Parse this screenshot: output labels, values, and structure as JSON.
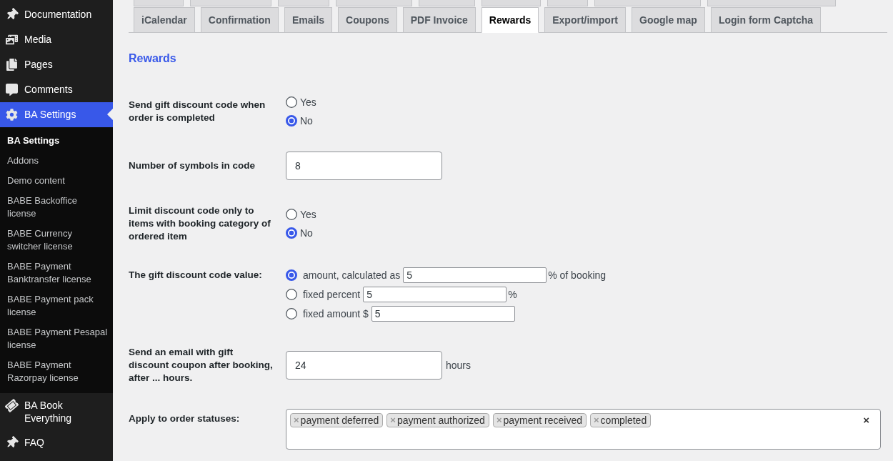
{
  "sidebar": {
    "items": [
      {
        "label": "Documentation",
        "selected": false
      },
      {
        "label": "Media",
        "selected": false
      },
      {
        "label": "Pages",
        "selected": false
      },
      {
        "label": "Comments",
        "selected": false
      },
      {
        "label": "BA Settings",
        "selected": true,
        "submenu": [
          {
            "label": "BA Settings",
            "selected": true
          },
          {
            "label": "Addons",
            "selected": false
          },
          {
            "label": "Demo content",
            "selected": false
          },
          {
            "label": "BABE Backoffice license",
            "selected": false
          },
          {
            "label": "BABE Currency switcher license",
            "selected": false
          },
          {
            "label": "BABE Payment Banktransfer license",
            "selected": false
          },
          {
            "label": "BABE Payment pack license",
            "selected": false
          },
          {
            "label": "BABE Payment Pesapal license",
            "selected": false
          },
          {
            "label": "BABE Payment Razorpay license",
            "selected": false
          }
        ]
      },
      {
        "label": "BA Book Everything",
        "selected": false
      },
      {
        "label": "FAQ",
        "selected": false
      }
    ]
  },
  "upper_tabs": [
    {
      "selected": false
    },
    {
      "selected": false
    },
    {
      "selected": false
    },
    {
      "selected": false
    },
    {
      "selected": false
    },
    {
      "selected": false
    },
    {
      "selected": false
    },
    {
      "selected": false
    },
    {
      "selected": false
    }
  ],
  "tabs": [
    {
      "label": "iCalendar",
      "selected": false
    },
    {
      "label": "Confirmation",
      "selected": false
    },
    {
      "label": "Emails",
      "selected": false
    },
    {
      "label": "Coupons",
      "selected": false
    },
    {
      "label": "PDF Invoice",
      "selected": false
    },
    {
      "label": "Rewards",
      "selected": true
    },
    {
      "label": "Export/import",
      "selected": false
    },
    {
      "label": "Google map",
      "selected": false
    },
    {
      "label": "Login form Captcha",
      "selected": false
    }
  ],
  "section_title": "Rewards",
  "fields": [
    {
      "kind": "radio",
      "label": "Send gift discount code when order is completed",
      "options": [
        {
          "label": "Yes",
          "selected": false
        },
        {
          "label": "No",
          "selected": true
        }
      ]
    },
    {
      "kind": "text",
      "label": "Number of symbols in code",
      "value": "8"
    },
    {
      "kind": "radio",
      "label": "Limit discount code only to items with booking category of ordered item",
      "options": [
        {
          "label": "Yes",
          "selected": false
        },
        {
          "label": "No",
          "selected": true
        }
      ]
    },
    {
      "kind": "radio_inputs",
      "label": "The gift discount code value:",
      "options": [
        {
          "label": "amount, calculated as",
          "value": "5",
          "suffix": "% of booking",
          "selected": true
        },
        {
          "label": "fixed percent",
          "value": "5",
          "suffix": "%",
          "selected": false
        },
        {
          "label": "fixed amount $",
          "value": "5",
          "selected": false
        }
      ]
    },
    {
      "kind": "text",
      "label": "Send an email with gift discount coupon after booking, after ... hours.",
      "value": "24",
      "suffix": "hours"
    },
    {
      "kind": "tags",
      "label": "Apply to order statuses:",
      "tags": [
        {
          "label": "payment deferred",
          "remove": "×"
        },
        {
          "label": "payment authorized",
          "remove": "×"
        },
        {
          "label": "payment received",
          "remove": "×"
        },
        {
          "label": "completed",
          "remove": "×"
        }
      ],
      "clear": "×"
    }
  ]
}
